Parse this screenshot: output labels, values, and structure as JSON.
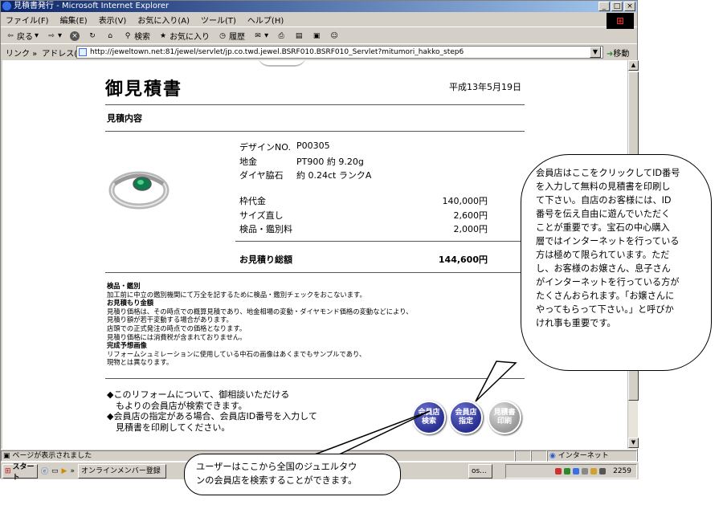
{
  "window": {
    "title": "見積書発行 - Microsoft Internet Explorer",
    "controls": [
      "_",
      "□",
      "×"
    ]
  },
  "menu": [
    "ファイル(F)",
    "編集(E)",
    "表示(V)",
    "お気に入り(A)",
    "ツール(T)",
    "ヘルプ(H)"
  ],
  "toolbar": {
    "back": "戻る",
    "search": "検索",
    "favorites": "お気に入り",
    "history": "履歴"
  },
  "address": {
    "links_label": "リンク »",
    "label": "アドレス(D)",
    "url": "http://jeweltown.net:81/jewel/servlet/jp.co.twd.jewel.BSRF010.BSRF010_Servlet?mitumori_hakko_step6",
    "go": "移動"
  },
  "page": {
    "title": "御見積書",
    "date": "平成13年5月19日",
    "section": "見積内容",
    "specs": [
      {
        "label": "デザインNO.",
        "value": "P00305"
      },
      {
        "label": "地金",
        "value": "PT900 約 9.20g"
      },
      {
        "label": "ダイヤ脇石",
        "value": "約 0.24ct ランクA"
      }
    ],
    "fees": [
      {
        "label": "枠代金",
        "amount": "140,000円"
      },
      {
        "label": "サイズ直し",
        "amount": "2,600円"
      },
      {
        "label": "検品・鑑別料",
        "amount": "2,000円"
      }
    ],
    "total": {
      "label": "お見積り総額",
      "amount": "144,600円"
    },
    "notes": [
      {
        "bold": true,
        "text": "検品・鑑別"
      },
      {
        "bold": false,
        "text": "加工前に中立の鑑別機関にて万全を記するために検品・鑑別チェックをおこないます。"
      },
      {
        "bold": true,
        "text": "お見積もり金額"
      },
      {
        "bold": false,
        "text": "見積り価格は、その時点での概算見積であり、地金相場の変動・ダイヤモンド価格の変動などにより、"
      },
      {
        "bold": false,
        "text": "見積り額が若干変動する場合があります。"
      },
      {
        "bold": false,
        "text": "店頭での正式発注の時点での価格となります。"
      },
      {
        "bold": false,
        "text": "見積り価格には消費税が含まれておりません。"
      },
      {
        "bold": true,
        "text": "完成予想画像"
      },
      {
        "bold": false,
        "text": "リフォームシュミレーションに使用している中石の画像はあくまでもサンプルであり、"
      },
      {
        "bold": false,
        "text": "現物とは異なります。"
      }
    ],
    "bullets": [
      "◆このリフォームについて、御相談いただける",
      "　もよりの会員店が検索できます。",
      "◆会員店の指定がある場合、会員店ID番号を入力して",
      "　見積書を印刷してください。"
    ],
    "buttons": [
      {
        "l1": "会員店",
        "l2": "検索",
        "color": "#2a3090"
      },
      {
        "l1": "会員店",
        "l2": "指定",
        "color": "#2a3090"
      },
      {
        "l1": "見積書",
        "l2": "印刷",
        "color": "#9a9a9a"
      }
    ]
  },
  "status": {
    "text": "ページが表示されました",
    "zone": "インターネット"
  },
  "taskbar": {
    "start": "スタート",
    "task1": "オンラインメンバー登録",
    "task2": "os...",
    "clock": "2259"
  },
  "callouts": {
    "member": [
      "会員店はここをクリックしてID番号",
      "を入力して無料の見積書を印刷し",
      "て下さい。自店のお客様には、ID",
      "番号を伝え自由に遊んでいただく",
      "ことが重要です。宝石の中心購入",
      "層ではインターネットを行っている",
      "方は極めて限られています。ただ",
      "し、お客様のお嬢さん、息子さん",
      "がインターネットを行っている方が",
      "たくさんおられます。「お嬢さんに",
      "やってもらって下さい。」と呼びか",
      "けれ事も重要です。"
    ],
    "user": [
      "ユーザーはここから全国のジュエルタウ",
      "ンの会員店を検索することができます。"
    ]
  }
}
